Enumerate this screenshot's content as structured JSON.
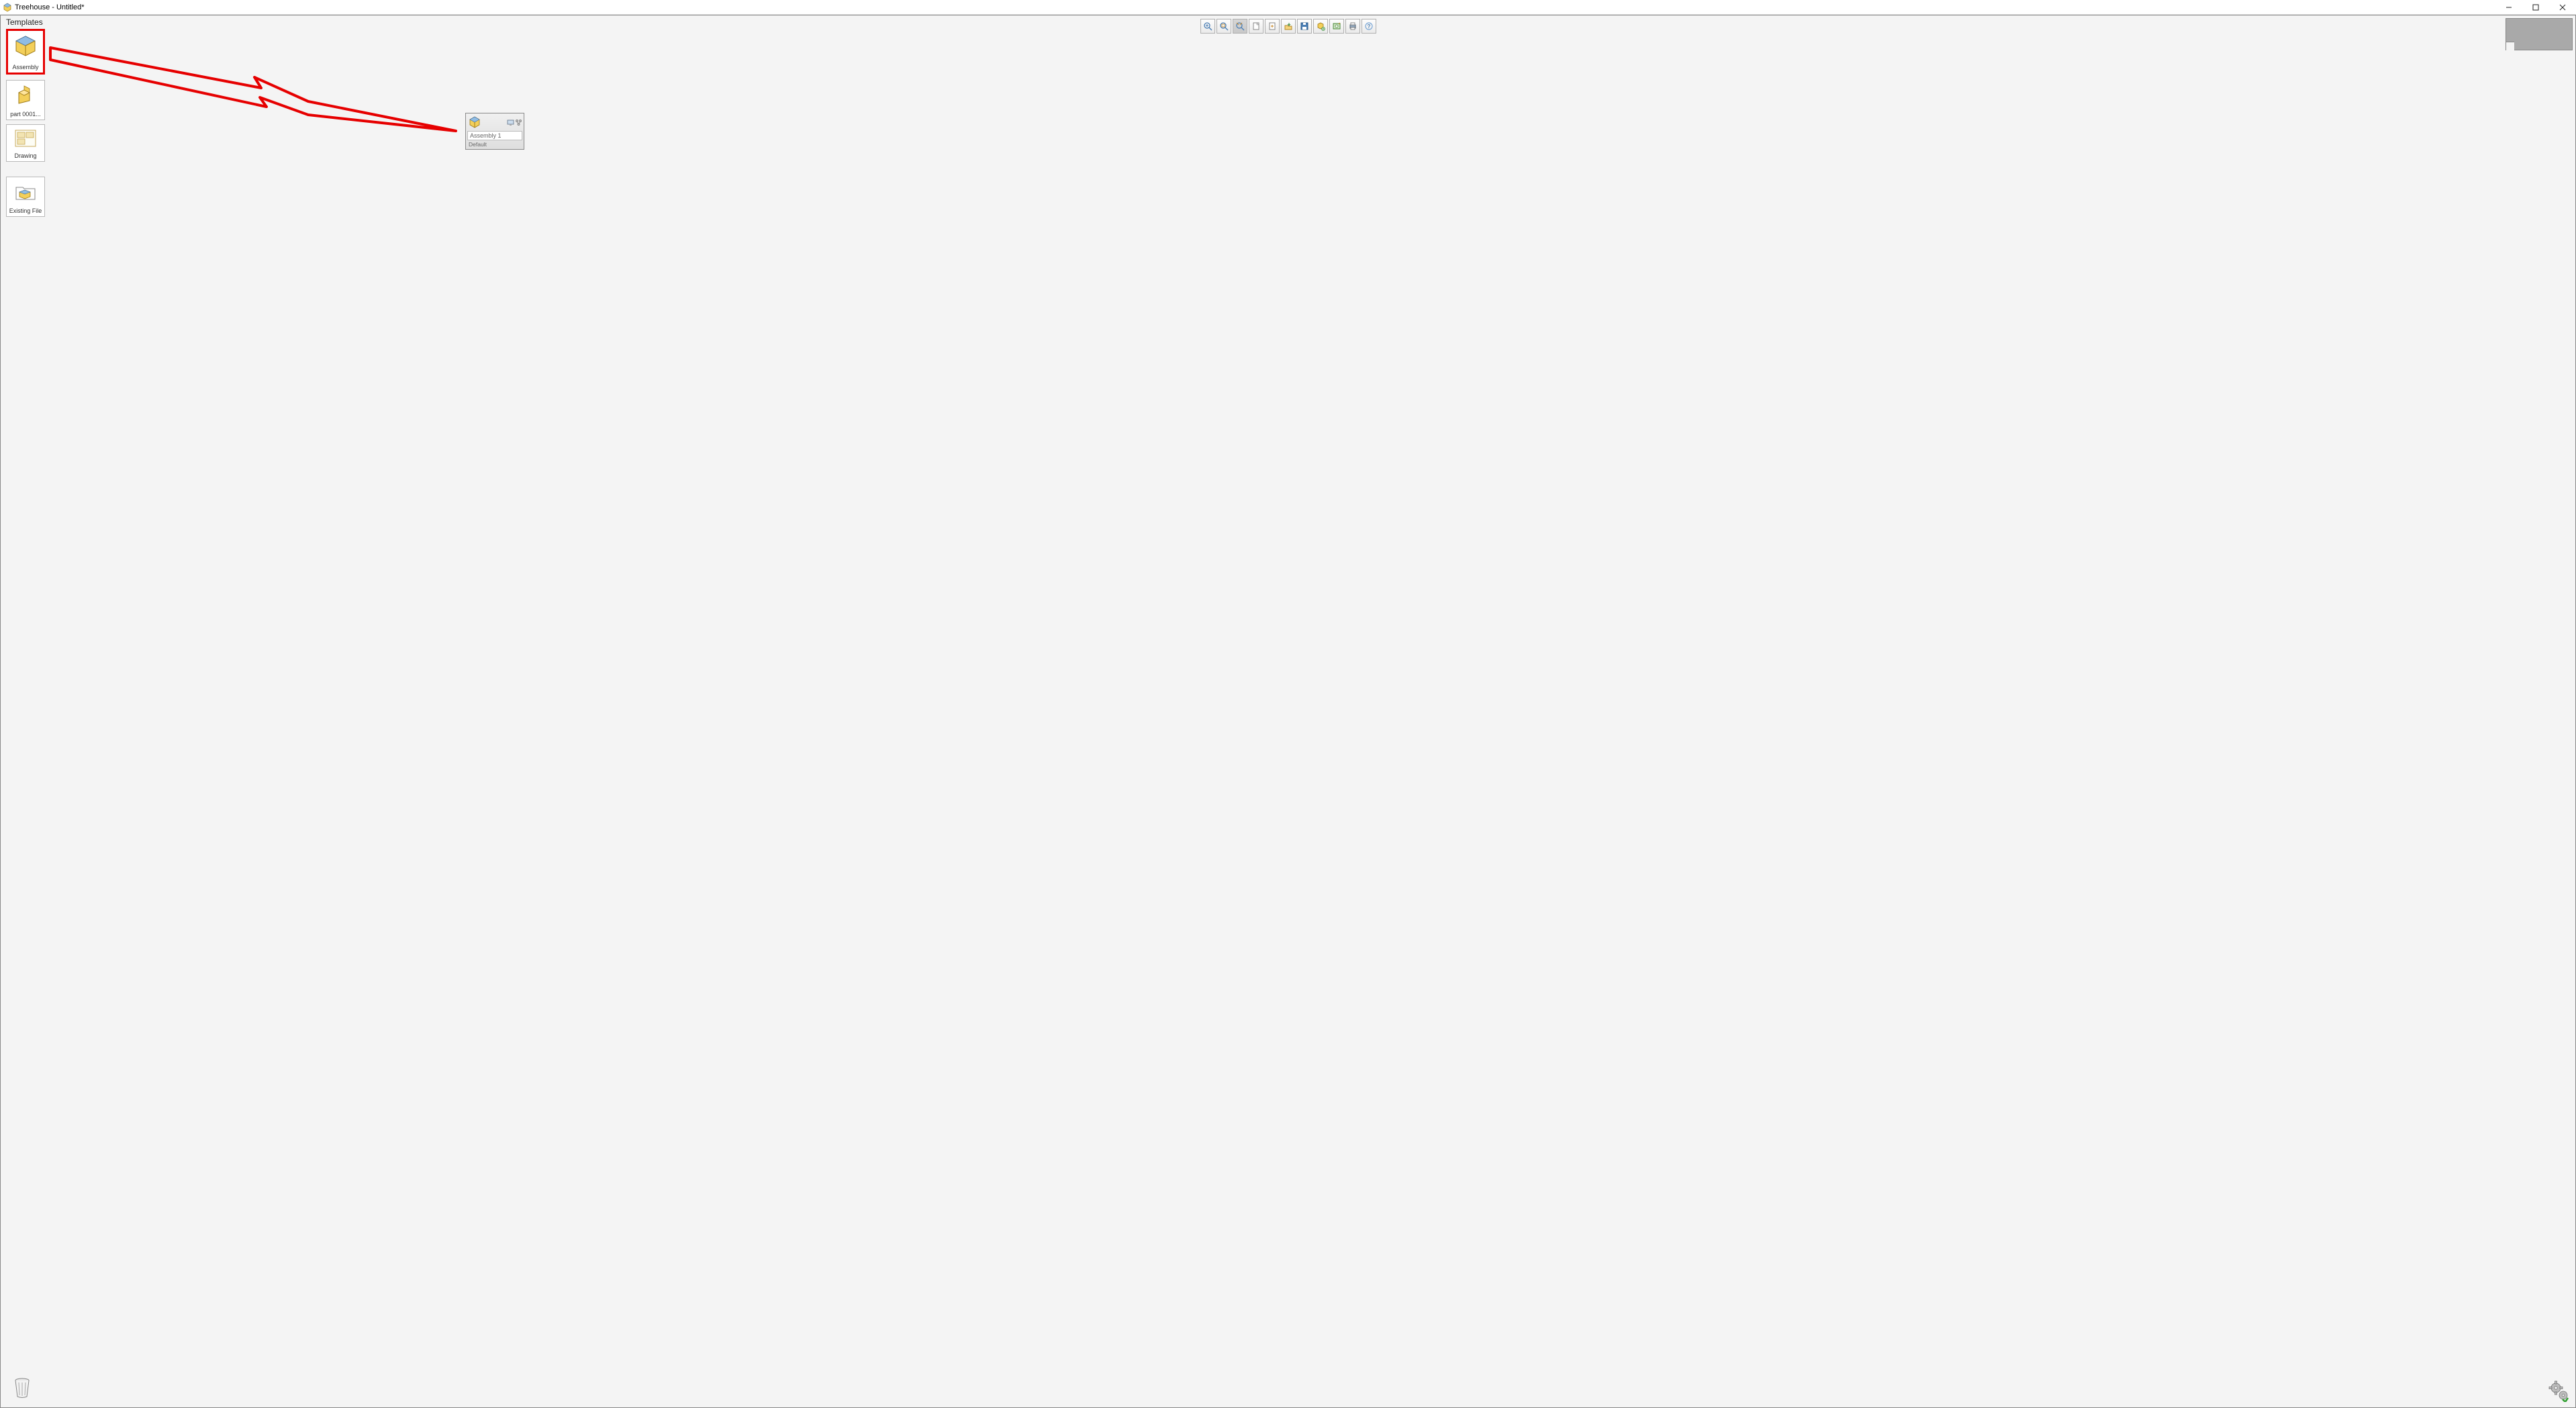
{
  "window": {
    "title": "Treehouse - Untitled*"
  },
  "templates": {
    "heading": "Templates",
    "items": [
      {
        "id": "assembly",
        "label": "Assembly"
      },
      {
        "id": "part",
        "label": "part 0001..."
      },
      {
        "id": "drawing",
        "label": "Drawing"
      },
      {
        "id": "existing",
        "label": "Existing File"
      }
    ]
  },
  "toolbar": {
    "buttons": [
      "zoom-in",
      "zoom-fit",
      "zoom-area",
      "new-document",
      "open",
      "import",
      "save",
      "export-image",
      "open-in-solidworks",
      "print",
      "help"
    ]
  },
  "canvas": {
    "node": {
      "name": "Assembly 1",
      "configuration": "Default"
    }
  },
  "icons": {
    "trash": "trash-icon",
    "settings": "settings-icon",
    "minimap_expand": "↗"
  }
}
